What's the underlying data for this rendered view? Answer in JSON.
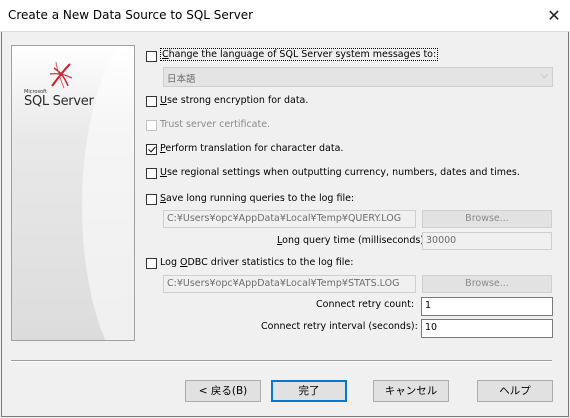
{
  "window": {
    "title": "Create a New Data Source to SQL Server",
    "close_glyph": "✕"
  },
  "banner": {
    "logo_small": "Microsoft",
    "logo_text": "SQL Server"
  },
  "options": {
    "change_language": {
      "label_pre": "C",
      "label_rest": "hange the language of SQL Server system messages to:",
      "checked": false,
      "language_value": "日本語",
      "chevron": "⌵"
    },
    "strong_encryption": {
      "label_pre": "",
      "label_u": "U",
      "label_rest": "se strong encryption for data.",
      "checked": false
    },
    "trust_cert": {
      "label": "Trust server certificate.",
      "checked": false
    },
    "perform_translation": {
      "label_u": "P",
      "label_rest": "erform translation for character data.",
      "checked": true
    },
    "regional_settings": {
      "label_u": "U",
      "label_rest": "se regional settings when outputting currency, numbers, dates and times.",
      "checked": false
    },
    "save_long_queries": {
      "label_u": "S",
      "label_rest": "ave long running queries to the log file:",
      "checked": false,
      "path": "C:¥Users¥opc¥AppData¥Local¥Temp¥QUERY.LOG",
      "browse": "Browse...",
      "time_label_u": "L",
      "time_label_rest": "ong query time (milliseconds):",
      "time_value": "30000"
    },
    "log_odbc": {
      "label_pre": "Log ",
      "label_u": "O",
      "label_rest": "DBC driver statistics to the log file:",
      "checked": false,
      "path": "C:¥Users¥opc¥AppData¥Local¥Temp¥STATS.LOG",
      "browse": "Browse..."
    },
    "retry_count": {
      "label": "Connect retry count:",
      "value": "1"
    },
    "retry_interval": {
      "label": "Connect retry interval (seconds):",
      "value": "10"
    }
  },
  "buttons": {
    "back": "< 戻る(B)",
    "finish": "完了",
    "cancel": "キャンセル",
    "help": "ヘルプ"
  },
  "colors": {
    "accent": "#0078d7",
    "logo_red": "#c8202f"
  }
}
